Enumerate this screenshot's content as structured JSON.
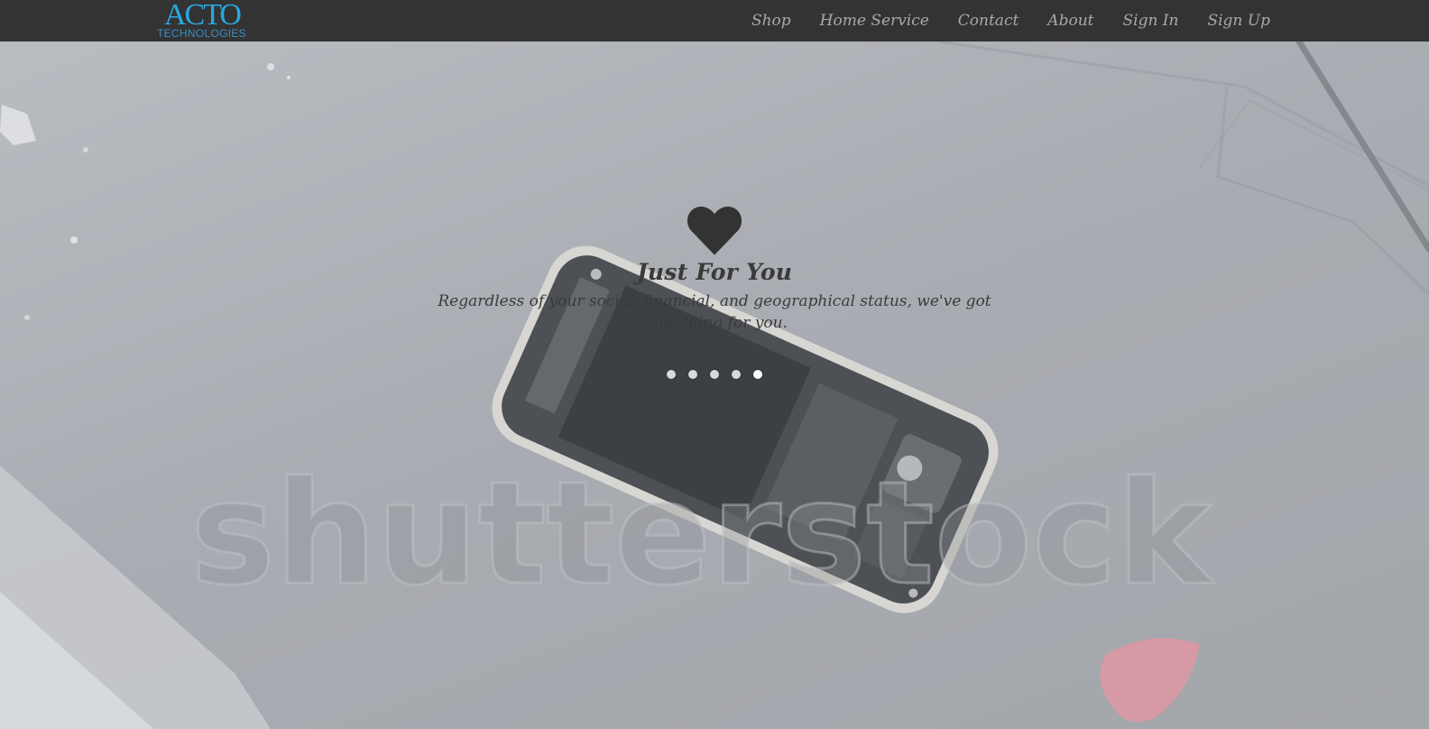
{
  "brand": {
    "logo_text": "ACTO",
    "logo_subtext": "TECHNOLOGIES"
  },
  "nav": {
    "items": [
      {
        "label": "Shop"
      },
      {
        "label": "Home Service"
      },
      {
        "label": "Contact"
      },
      {
        "label": "About"
      },
      {
        "label": "Sign In"
      },
      {
        "label": "Sign Up"
      }
    ]
  },
  "hero": {
    "icon": "heart-icon",
    "title": "Just For You",
    "text": "Regardless of your social, financial, and geographical status, we've got something for you.",
    "watermark": "shutterstock",
    "slides": {
      "count": 5,
      "active": 5
    }
  },
  "colors": {
    "navbar": "#333333",
    "logo": "#29a8e0",
    "nav_text": "#a9a9a9",
    "hero_text": "#333333"
  }
}
